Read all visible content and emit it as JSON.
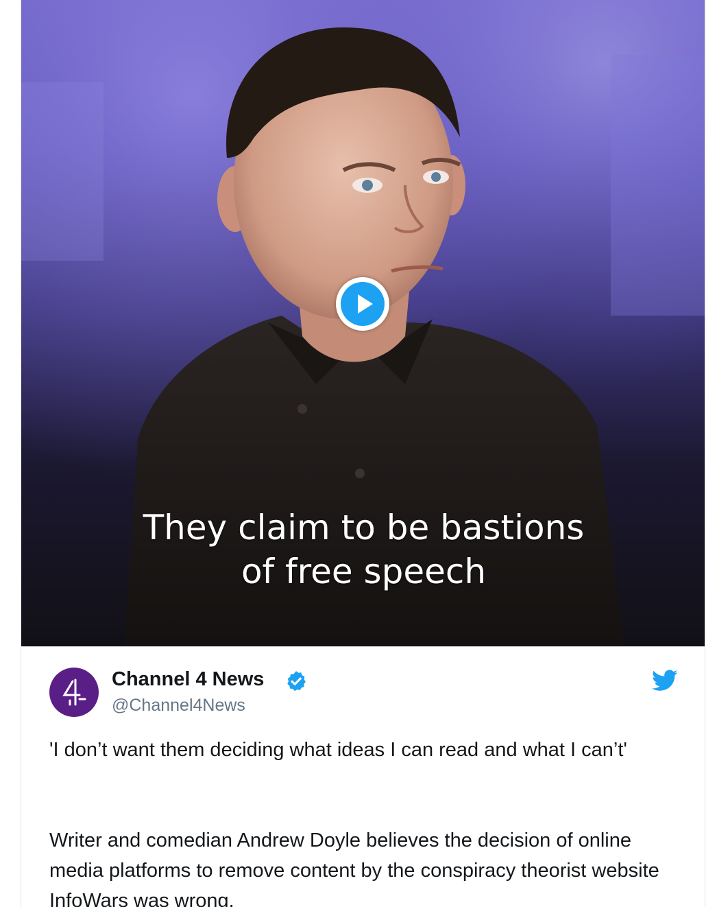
{
  "video": {
    "caption_line1": "They claim to be bastions",
    "caption_line2": "of free speech",
    "play_icon": "play-icon"
  },
  "tweet": {
    "author_name": "Channel 4 News",
    "author_handle": "@Channel4News",
    "verified_icon": "verified-badge-icon",
    "avatar_icon": "channel-4-logo",
    "platform_icon": "twitter-bird-icon",
    "text_paragraph1": "'I don’t want them deciding what ideas I can read and what I can’t'",
    "text_paragraph2": "Writer and comedian Andrew Doyle believes the decision of online media platforms to remove content by the conspiracy theorist website InfoWars was wrong."
  },
  "colors": {
    "twitter_blue": "#1da1f2",
    "channel4_purple": "#5a1f86",
    "text_primary": "#14171a",
    "text_secondary": "#657786"
  }
}
